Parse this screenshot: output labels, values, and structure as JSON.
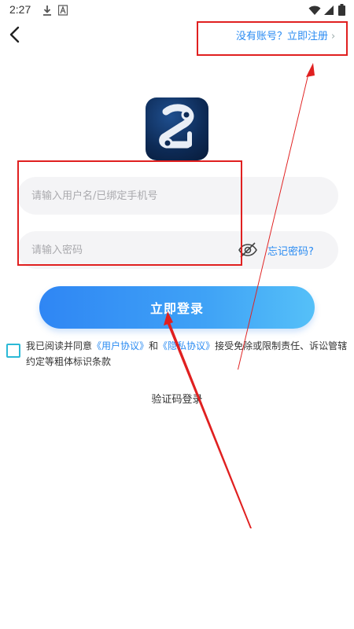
{
  "status_bar": {
    "time": "2:27",
    "left_icons": [
      "download-icon",
      "font-a-icon"
    ],
    "right_icons": [
      "wifi-icon",
      "signal-icon",
      "battery-icon"
    ]
  },
  "header": {
    "back_icon": "back-arrow-icon",
    "register_link": "没有账号？立即注册",
    "register_chevron": "›"
  },
  "logo": {
    "icon": "app-logo",
    "bg": "#0d2a55"
  },
  "form": {
    "username_placeholder": "请输入用户名/已绑定手机号",
    "username_value": "",
    "password_placeholder": "请输入密码",
    "password_value": "",
    "eye_icon": "eye-hidden-icon",
    "forgot_label": "忘记密码?"
  },
  "login_button": {
    "label": "立即登录"
  },
  "agreement": {
    "checked": false,
    "text_1": "我已阅读并同意",
    "link_user": "《用户协议》",
    "text_and": "和",
    "link_privacy": "《隐私协议》",
    "text_2": "接受免除或限制责任、诉讼管辖约定等粗体标识条款"
  },
  "sms_login": {
    "label": "验证码登录"
  },
  "colors": {
    "accent": "#2a8bf2",
    "button_start": "#2f86f4",
    "button_end": "#55c0f8",
    "checkbox": "#2bb9d6",
    "annotation": "#e02020"
  }
}
